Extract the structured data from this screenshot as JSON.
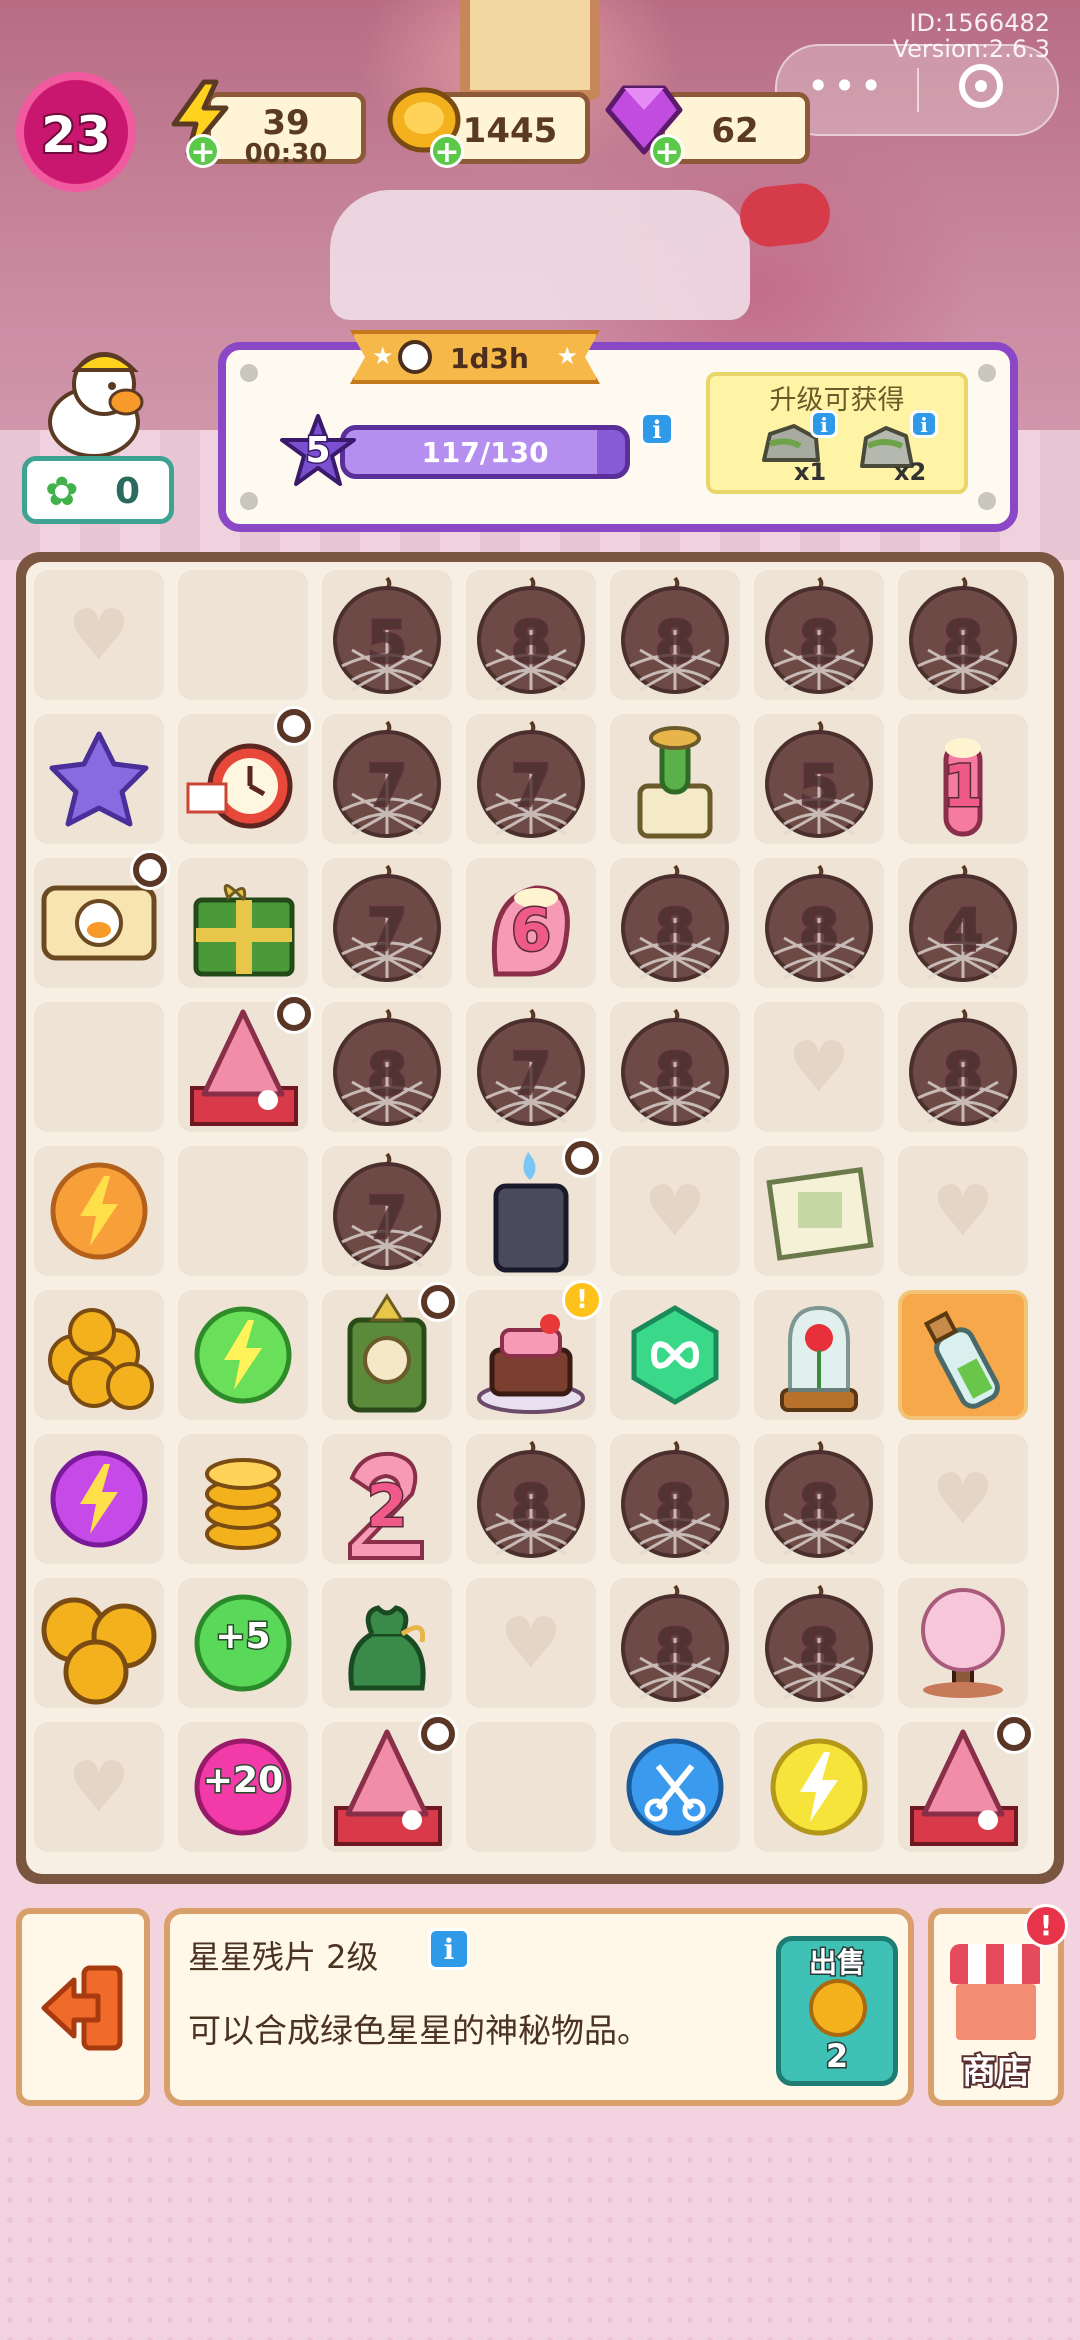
{
  "system": {
    "id_text": "ID:1566482",
    "version_text": "Version:2.6.3"
  },
  "capsule": {
    "more_icon": "more-dots-icon",
    "close_icon": "target-circle-icon"
  },
  "player": {
    "level": "23"
  },
  "resources": {
    "energy": {
      "value": "39",
      "timer": "00:30",
      "icon": "lightning-icon"
    },
    "coins": {
      "value": "1445",
      "icon": "coin-icon"
    },
    "gems": {
      "value": "62",
      "icon": "gem-icon"
    }
  },
  "clover": {
    "value": "0"
  },
  "event": {
    "time_left": "1d3h",
    "level": "5",
    "progress_text": "117/130",
    "progress": 0.9,
    "reward_title": "升级可获得",
    "rewards": [
      {
        "name": "stone",
        "count": "x1"
      },
      {
        "name": "stone-pile",
        "count": "x2"
      }
    ]
  },
  "board": {
    "cols": 7,
    "rows": 9,
    "cells": [
      [
        "heart",
        "empty",
        "web-5",
        "web-8",
        "web-8",
        "web-8",
        "web-8"
      ],
      [
        "star-fragment",
        "alarm-clock",
        "web-7",
        "web-7",
        "cactus-pot",
        "web-5",
        "candle-1"
      ],
      [
        "scale",
        "gift-box",
        "web-7",
        "candle-6",
        "web-8",
        "web-8",
        "web-4"
      ],
      [
        "empty",
        "pink-tree-gift",
        "web-8",
        "web-7",
        "web-8",
        "heart",
        "web-8"
      ],
      [
        "orange-energy",
        "empty",
        "web-7",
        "lighter",
        "heart",
        "recipe-book",
        "heart"
      ],
      [
        "coin-pile-big",
        "green-energy",
        "cabinet-clock",
        "cake",
        "infinity-hex",
        "rose-dome",
        "bottle"
      ],
      [
        "purple-energy",
        "coin-stack",
        "candle-2",
        "web-8",
        "web-8",
        "web-8",
        "heart"
      ],
      [
        "coins-big",
        "plus5",
        "money-bag",
        "heart",
        "web-8",
        "web-8",
        "sakura-tree"
      ],
      [
        "heart",
        "plus20",
        "pink-tree-gift",
        "empty",
        "scissors",
        "yellow-energy",
        "pink-tree-gift"
      ]
    ],
    "badges": [
      [
        1,
        1
      ],
      [
        2,
        0
      ],
      [
        3,
        1
      ],
      [
        4,
        3
      ],
      [
        5,
        2
      ],
      [
        8,
        2
      ],
      [
        8,
        6
      ]
    ],
    "alerts": [
      [
        5,
        3
      ]
    ],
    "selected": [
      5,
      6
    ],
    "labels": {
      "plus5": "+5",
      "plus20": "+20",
      "candle-1": "1",
      "candle-6": "6",
      "candle-2": "2",
      "web-5": "5",
      "web-8": "8",
      "web-7": "7",
      "web-4": "4"
    }
  },
  "info_bar": {
    "item_name": "星星残片 2级",
    "description": "可以合成绿色星星的神秘物品。",
    "sell_label": "出售",
    "sell_price": "2",
    "shop_label": "商店",
    "shop_alert": "!"
  },
  "colors": {
    "accent_purple": "#8a47c6",
    "board_border": "#7a5540",
    "sell_teal": "#3fc2b5"
  }
}
